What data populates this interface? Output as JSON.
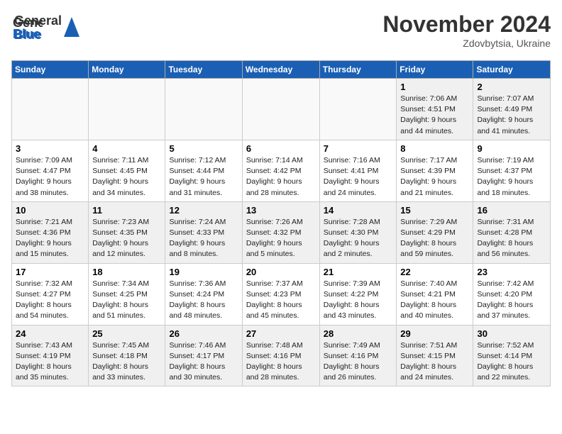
{
  "header": {
    "logo_general": "General",
    "logo_blue": "Blue",
    "month_title": "November 2024",
    "location": "Zdovbytsia, Ukraine"
  },
  "weekdays": [
    "Sunday",
    "Monday",
    "Tuesday",
    "Wednesday",
    "Thursday",
    "Friday",
    "Saturday"
  ],
  "weeks": [
    [
      {
        "day": "",
        "info": ""
      },
      {
        "day": "",
        "info": ""
      },
      {
        "day": "",
        "info": ""
      },
      {
        "day": "",
        "info": ""
      },
      {
        "day": "",
        "info": ""
      },
      {
        "day": "1",
        "info": "Sunrise: 7:06 AM\nSunset: 4:51 PM\nDaylight: 9 hours\nand 44 minutes."
      },
      {
        "day": "2",
        "info": "Sunrise: 7:07 AM\nSunset: 4:49 PM\nDaylight: 9 hours\nand 41 minutes."
      }
    ],
    [
      {
        "day": "3",
        "info": "Sunrise: 7:09 AM\nSunset: 4:47 PM\nDaylight: 9 hours\nand 38 minutes."
      },
      {
        "day": "4",
        "info": "Sunrise: 7:11 AM\nSunset: 4:45 PM\nDaylight: 9 hours\nand 34 minutes."
      },
      {
        "day": "5",
        "info": "Sunrise: 7:12 AM\nSunset: 4:44 PM\nDaylight: 9 hours\nand 31 minutes."
      },
      {
        "day": "6",
        "info": "Sunrise: 7:14 AM\nSunset: 4:42 PM\nDaylight: 9 hours\nand 28 minutes."
      },
      {
        "day": "7",
        "info": "Sunrise: 7:16 AM\nSunset: 4:41 PM\nDaylight: 9 hours\nand 24 minutes."
      },
      {
        "day": "8",
        "info": "Sunrise: 7:17 AM\nSunset: 4:39 PM\nDaylight: 9 hours\nand 21 minutes."
      },
      {
        "day": "9",
        "info": "Sunrise: 7:19 AM\nSunset: 4:37 PM\nDaylight: 9 hours\nand 18 minutes."
      }
    ],
    [
      {
        "day": "10",
        "info": "Sunrise: 7:21 AM\nSunset: 4:36 PM\nDaylight: 9 hours\nand 15 minutes."
      },
      {
        "day": "11",
        "info": "Sunrise: 7:23 AM\nSunset: 4:35 PM\nDaylight: 9 hours\nand 12 minutes."
      },
      {
        "day": "12",
        "info": "Sunrise: 7:24 AM\nSunset: 4:33 PM\nDaylight: 9 hours\nand 8 minutes."
      },
      {
        "day": "13",
        "info": "Sunrise: 7:26 AM\nSunset: 4:32 PM\nDaylight: 9 hours\nand 5 minutes."
      },
      {
        "day": "14",
        "info": "Sunrise: 7:28 AM\nSunset: 4:30 PM\nDaylight: 9 hours\nand 2 minutes."
      },
      {
        "day": "15",
        "info": "Sunrise: 7:29 AM\nSunset: 4:29 PM\nDaylight: 8 hours\nand 59 minutes."
      },
      {
        "day": "16",
        "info": "Sunrise: 7:31 AM\nSunset: 4:28 PM\nDaylight: 8 hours\nand 56 minutes."
      }
    ],
    [
      {
        "day": "17",
        "info": "Sunrise: 7:32 AM\nSunset: 4:27 PM\nDaylight: 8 hours\nand 54 minutes."
      },
      {
        "day": "18",
        "info": "Sunrise: 7:34 AM\nSunset: 4:25 PM\nDaylight: 8 hours\nand 51 minutes."
      },
      {
        "day": "19",
        "info": "Sunrise: 7:36 AM\nSunset: 4:24 PM\nDaylight: 8 hours\nand 48 minutes."
      },
      {
        "day": "20",
        "info": "Sunrise: 7:37 AM\nSunset: 4:23 PM\nDaylight: 8 hours\nand 45 minutes."
      },
      {
        "day": "21",
        "info": "Sunrise: 7:39 AM\nSunset: 4:22 PM\nDaylight: 8 hours\nand 43 minutes."
      },
      {
        "day": "22",
        "info": "Sunrise: 7:40 AM\nSunset: 4:21 PM\nDaylight: 8 hours\nand 40 minutes."
      },
      {
        "day": "23",
        "info": "Sunrise: 7:42 AM\nSunset: 4:20 PM\nDaylight: 8 hours\nand 37 minutes."
      }
    ],
    [
      {
        "day": "24",
        "info": "Sunrise: 7:43 AM\nSunset: 4:19 PM\nDaylight: 8 hours\nand 35 minutes."
      },
      {
        "day": "25",
        "info": "Sunrise: 7:45 AM\nSunset: 4:18 PM\nDaylight: 8 hours\nand 33 minutes."
      },
      {
        "day": "26",
        "info": "Sunrise: 7:46 AM\nSunset: 4:17 PM\nDaylight: 8 hours\nand 30 minutes."
      },
      {
        "day": "27",
        "info": "Sunrise: 7:48 AM\nSunset: 4:16 PM\nDaylight: 8 hours\nand 28 minutes."
      },
      {
        "day": "28",
        "info": "Sunrise: 7:49 AM\nSunset: 4:16 PM\nDaylight: 8 hours\nand 26 minutes."
      },
      {
        "day": "29",
        "info": "Sunrise: 7:51 AM\nSunset: 4:15 PM\nDaylight: 8 hours\nand 24 minutes."
      },
      {
        "day": "30",
        "info": "Sunrise: 7:52 AM\nSunset: 4:14 PM\nDaylight: 8 hours\nand 22 minutes."
      }
    ]
  ]
}
